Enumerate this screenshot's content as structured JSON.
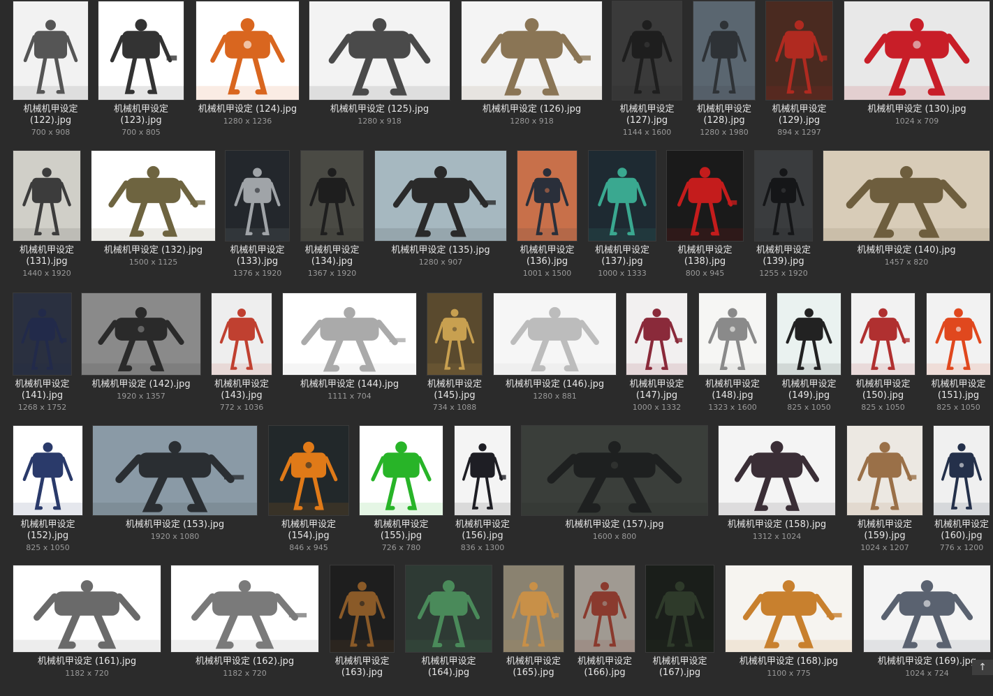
{
  "items": [
    {
      "name": "机械机甲设定 (122).jpg",
      "dims": "700 x 908",
      "bg": "#f2f2f2",
      "fg": "#555555"
    },
    {
      "name": "机械机甲设定 (123).jpg",
      "dims": "700 x 805",
      "bg": "#ffffff",
      "fg": "#333333"
    },
    {
      "name": "机械机甲设定 (124).jpg",
      "dims": "1280 x 1236",
      "bg": "#ffffff",
      "fg": "#d9661f"
    },
    {
      "name": "机械机甲设定 (125).jpg",
      "dims": "1280 x 918",
      "bg": "#f3f3f3",
      "fg": "#4a4a4a"
    },
    {
      "name": "机械机甲设定 (126).jpg",
      "dims": "1280 x 918",
      "bg": "#f4f4f4",
      "fg": "#8a7555"
    },
    {
      "name": "机械机甲设定 (127).jpg",
      "dims": "1144 x 1600",
      "bg": "#3a3a3a",
      "fg": "#1e1e1e"
    },
    {
      "name": "机械机甲设定 (128).jpg",
      "dims": "1280 x 1980",
      "bg": "#5a6670",
      "fg": "#2e3236"
    },
    {
      "name": "机械机甲设定 (129).jpg",
      "dims": "894 x 1297",
      "bg": "#4a2a20",
      "fg": "#b02a20"
    },
    {
      "name": "机械机甲设定 (130).jpg",
      "dims": "1024 x 709",
      "bg": "#e8e8e8",
      "fg": "#c81e28"
    },
    {
      "name": "机械机甲设定 (131).jpg",
      "dims": "1440 x 1920",
      "bg": "#d0cfc8",
      "fg": "#3c3c3c"
    },
    {
      "name": "机械机甲设定 (132).jpg",
      "dims": "1500 x 1125",
      "bg": "#ffffff",
      "fg": "#6e6440"
    },
    {
      "name": "机械机甲设定 (133).jpg",
      "dims": "1376 x 1920",
      "bg": "#23272c",
      "fg": "#a0a4a8"
    },
    {
      "name": "机械机甲设定 (134).jpg",
      "dims": "1367 x 1920",
      "bg": "#4a4a44",
      "fg": "#1e1e1e"
    },
    {
      "name": "机械机甲设定 (135).jpg",
      "dims": "1280 x 907",
      "bg": "#a6b8c0",
      "fg": "#2a2a2a"
    },
    {
      "name": "机械机甲设定 (136).jpg",
      "dims": "1001 x 1500",
      "bg": "#c8704a",
      "fg": "#2a2f3a"
    },
    {
      "name": "机械机甲设定 (137).jpg",
      "dims": "1000 x 1333",
      "bg": "#1e2a32",
      "fg": "#3aa890"
    },
    {
      "name": "机械机甲设定 (138).jpg",
      "dims": "800 x 945",
      "bg": "#1a1a1a",
      "fg": "#c41c1c"
    },
    {
      "name": "机械机甲设定 (139).jpg",
      "dims": "1255 x 1920",
      "bg": "#3a3c3e",
      "fg": "#151618"
    },
    {
      "name": "机械机甲设定 (140).jpg",
      "dims": "1457 x 820",
      "bg": "#d8ccb8",
      "fg": "#6e5e3e"
    },
    {
      "name": "机械机甲设定 (141).jpg",
      "dims": "1268 x 1752",
      "bg": "#2a3040",
      "fg": "#222a4a"
    },
    {
      "name": "机械机甲设定 (142).jpg",
      "dims": "1920 x 1357",
      "bg": "#8a8a8a",
      "fg": "#2a2a2a"
    },
    {
      "name": "机械机甲设定 (143).jpg",
      "dims": "772 x 1036",
      "bg": "#eeeeee",
      "fg": "#c04030"
    },
    {
      "name": "机械机甲设定 (144).jpg",
      "dims": "1111 x 704",
      "bg": "#ffffff",
      "fg": "#aaaaaa"
    },
    {
      "name": "机械机甲设定 (145).jpg",
      "dims": "734 x 1088",
      "bg": "#5a4a2e",
      "fg": "#c8a050"
    },
    {
      "name": "机械机甲设定 (146).jpg",
      "dims": "1280 x 881",
      "bg": "#f6f6f6",
      "fg": "#bcbcbc"
    },
    {
      "name": "机械机甲设定 (147).jpg",
      "dims": "1000 x 1332",
      "bg": "#f2f0f0",
      "fg": "#8a2a3a"
    },
    {
      "name": "机械机甲设定 (148).jpg",
      "dims": "1323 x 1600",
      "bg": "#f6f6f4",
      "fg": "#8a8a8a"
    },
    {
      "name": "机械机甲设定 (149).jpg",
      "dims": "825 x 1050",
      "bg": "#eaf2f0",
      "fg": "#222222"
    },
    {
      "name": "机械机甲设定 (150).jpg",
      "dims": "825 x 1050",
      "bg": "#f2f2f2",
      "fg": "#b03030"
    },
    {
      "name": "机械机甲设定 (151).jpg",
      "dims": "825 x 1050",
      "bg": "#f2f2f2",
      "fg": "#e0481e"
    },
    {
      "name": "机械机甲设定 (152).jpg",
      "dims": "825 x 1050",
      "bg": "#ffffff",
      "fg": "#2a3a6a"
    },
    {
      "name": "机械机甲设定 (153).jpg",
      "dims": "1920 x 1080",
      "bg": "#8a9aa6",
      "fg": "#2a2e32"
    },
    {
      "name": "机械机甲设定 (154).jpg",
      "dims": "846 x 945",
      "bg": "#22282a",
      "fg": "#e07a18"
    },
    {
      "name": "机械机甲设定 (155).jpg",
      "dims": "726 x 780",
      "bg": "#ffffff",
      "fg": "#28b428"
    },
    {
      "name": "机械机甲设定 (156).jpg",
      "dims": "836 x 1300",
      "bg": "#f4f4f4",
      "fg": "#1e1e24"
    },
    {
      "name": "机械机甲设定 (157).jpg",
      "dims": "1600 x 800",
      "bg": "#3a3e3a",
      "fg": "#1e2020"
    },
    {
      "name": "机械机甲设定 (158).jpg",
      "dims": "1312 x 1024",
      "bg": "#f4f4f4",
      "fg": "#3a2e36"
    },
    {
      "name": "机械机甲设定 (159).jpg",
      "dims": "1024 x 1207",
      "bg": "#ece8e2",
      "fg": "#9a7048"
    },
    {
      "name": "机械机甲设定 (160).jpg",
      "dims": "776 x 1200",
      "bg": "#f0f0f0",
      "fg": "#24304a"
    },
    {
      "name": "机械机甲设定 (161).jpg",
      "dims": "1182 x 720",
      "bg": "#ffffff",
      "fg": "#6a6a6a"
    },
    {
      "name": "机械机甲设定 (162).jpg",
      "dims": "1182 x 720",
      "bg": "#ffffff",
      "fg": "#7a7a7a"
    },
    {
      "name": "机械机甲设定 (163).jpg",
      "dims": "",
      "bg": "#1e1e1e",
      "fg": "#8a5a28"
    },
    {
      "name": "机械机甲设定 (164).jpg",
      "dims": "",
      "bg": "#2e3a34",
      "fg": "#4a8a5a"
    },
    {
      "name": "机械机甲设定 (165).jpg",
      "dims": "",
      "bg": "#8a8270",
      "fg": "#c89048"
    },
    {
      "name": "机械机甲设定 (166).jpg",
      "dims": "",
      "bg": "#a09a92",
      "fg": "#8a3a2e"
    },
    {
      "name": "机械机甲设定 (167).jpg",
      "dims": "",
      "bg": "#1a1e1a",
      "fg": "#2e3a2a"
    },
    {
      "name": "机械机甲设定 (168).jpg",
      "dims": "1100 x 775",
      "bg": "#f6f4f0",
      "fg": "#c8802e"
    },
    {
      "name": "机械机甲设定 (169).jpg",
      "dims": "1024 x 724",
      "bg": "#f4f4f4",
      "fg": "#5a6270"
    }
  ],
  "scroll_top": {
    "glyph": "↑",
    "icon": "arrow-up-icon"
  }
}
